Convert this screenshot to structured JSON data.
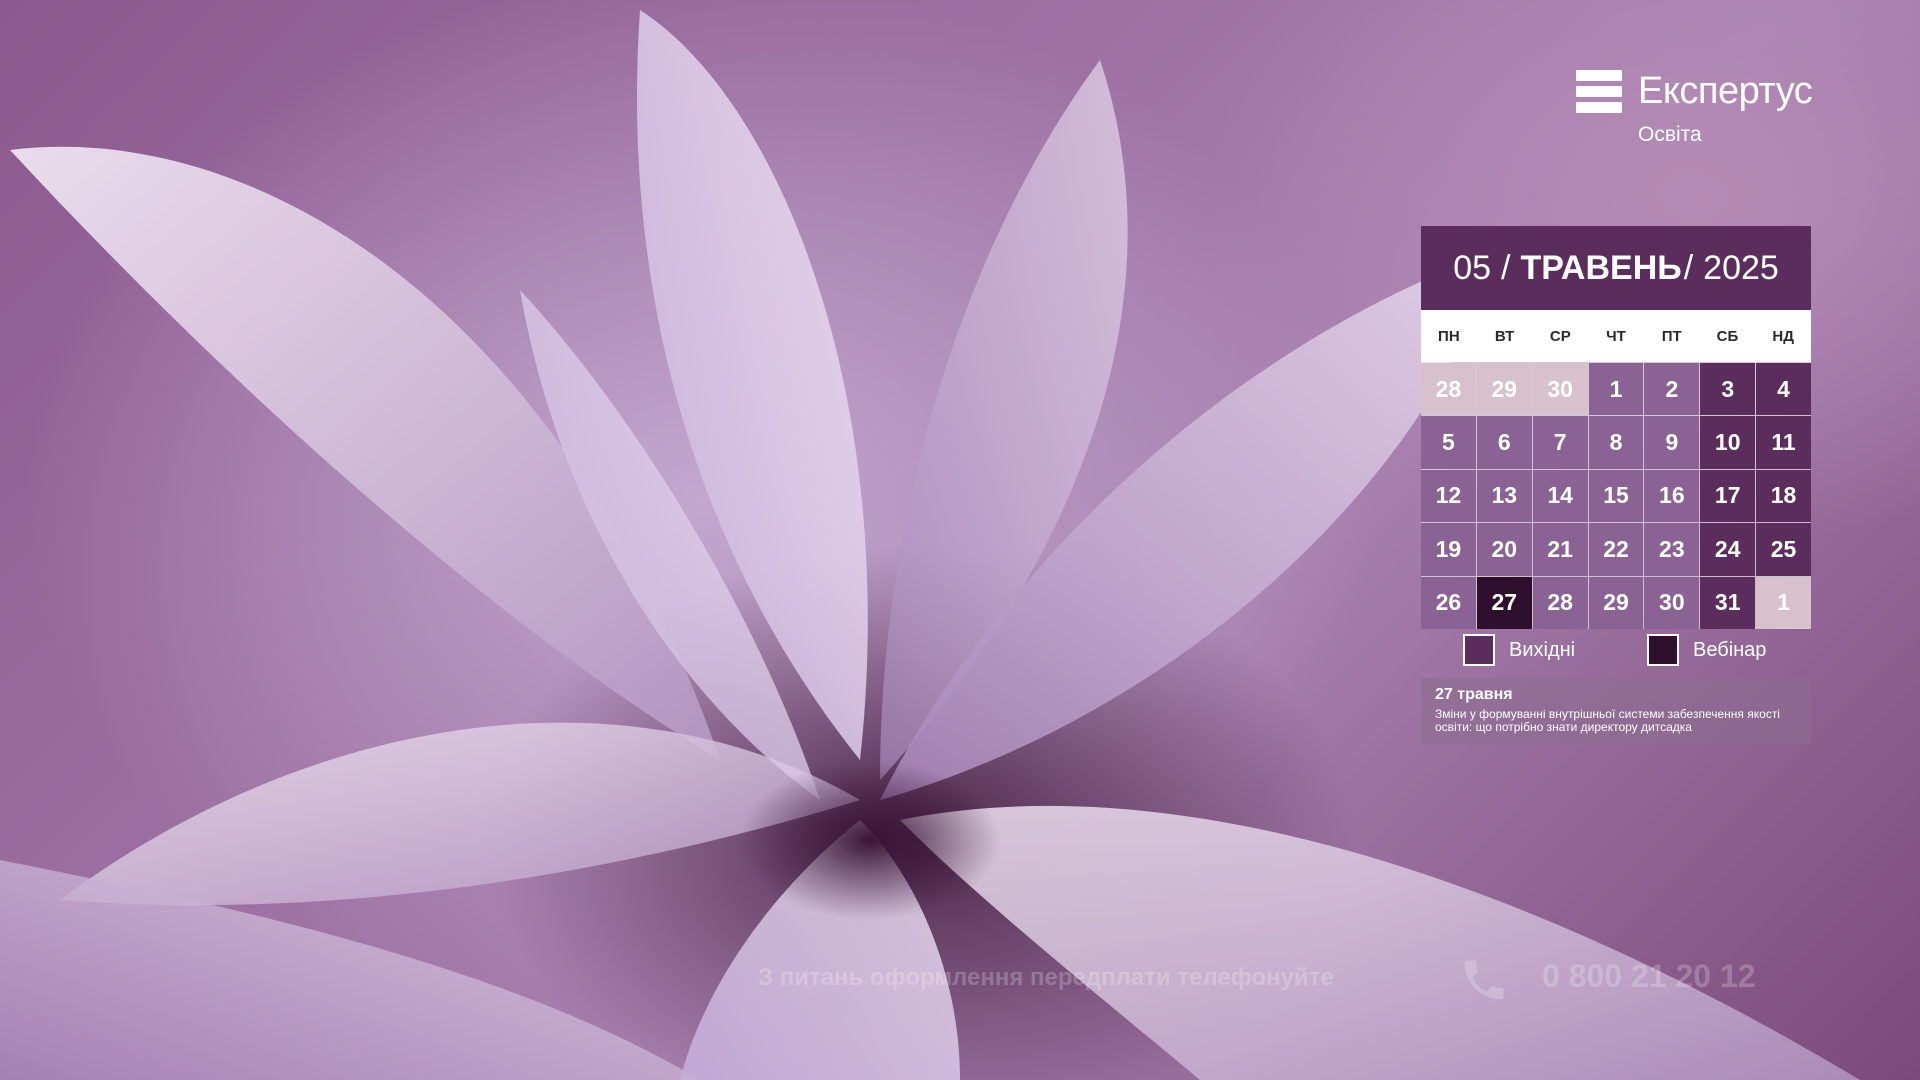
{
  "brand": {
    "name": "Експертус",
    "sub": "Освіта"
  },
  "calendar": {
    "month_num": "05",
    "sep1": "/",
    "month_name": "ТРАВЕНЬ",
    "sep2": "/",
    "year": "2025",
    "weekdays": [
      "ПН",
      "ВТ",
      "СР",
      "ЧТ",
      "ПТ",
      "СБ",
      "НД"
    ],
    "days": [
      {
        "label": "28",
        "kind": "other"
      },
      {
        "label": "29",
        "kind": "other"
      },
      {
        "label": "30",
        "kind": "other"
      },
      {
        "label": "1",
        "kind": "work"
      },
      {
        "label": "2",
        "kind": "work"
      },
      {
        "label": "3",
        "kind": "weekend"
      },
      {
        "label": "4",
        "kind": "weekend"
      },
      {
        "label": "5",
        "kind": "work"
      },
      {
        "label": "6",
        "kind": "work"
      },
      {
        "label": "7",
        "kind": "work"
      },
      {
        "label": "8",
        "kind": "work"
      },
      {
        "label": "9",
        "kind": "work"
      },
      {
        "label": "10",
        "kind": "weekend"
      },
      {
        "label": "11",
        "kind": "weekend"
      },
      {
        "label": "12",
        "kind": "work"
      },
      {
        "label": "13",
        "kind": "work"
      },
      {
        "label": "14",
        "kind": "work"
      },
      {
        "label": "15",
        "kind": "work"
      },
      {
        "label": "16",
        "kind": "work"
      },
      {
        "label": "17",
        "kind": "weekend"
      },
      {
        "label": "18",
        "kind": "weekend"
      },
      {
        "label": "19",
        "kind": "work"
      },
      {
        "label": "20",
        "kind": "work"
      },
      {
        "label": "21",
        "kind": "work"
      },
      {
        "label": "22",
        "kind": "work"
      },
      {
        "label": "23",
        "kind": "work"
      },
      {
        "label": "24",
        "kind": "weekend"
      },
      {
        "label": "25",
        "kind": "weekend"
      },
      {
        "label": "26",
        "kind": "work"
      },
      {
        "label": "27",
        "kind": "webinar"
      },
      {
        "label": "28",
        "kind": "work"
      },
      {
        "label": "29",
        "kind": "work"
      },
      {
        "label": "30",
        "kind": "work"
      },
      {
        "label": "31",
        "kind": "weekend"
      },
      {
        "label": "1",
        "kind": "other"
      }
    ],
    "legend": {
      "weekend": "Вихідні",
      "webinar": "Вебінар"
    },
    "event": {
      "date": "27 травня",
      "title": "Зміни у формуванні внутрішньої системи забезпечення якості освіти: що потрібно знати директору дитсадка"
    }
  },
  "footer": {
    "text": "З питань оформлення передплати телефонуйте",
    "phone": "0 800 21 20 12"
  },
  "colors": {
    "header": "#5b2d5c",
    "workday": "#8a6293",
    "weekend": "#5b2d5c",
    "other_month": "#d8c0cc",
    "webinar": "#2e0f2e"
  }
}
